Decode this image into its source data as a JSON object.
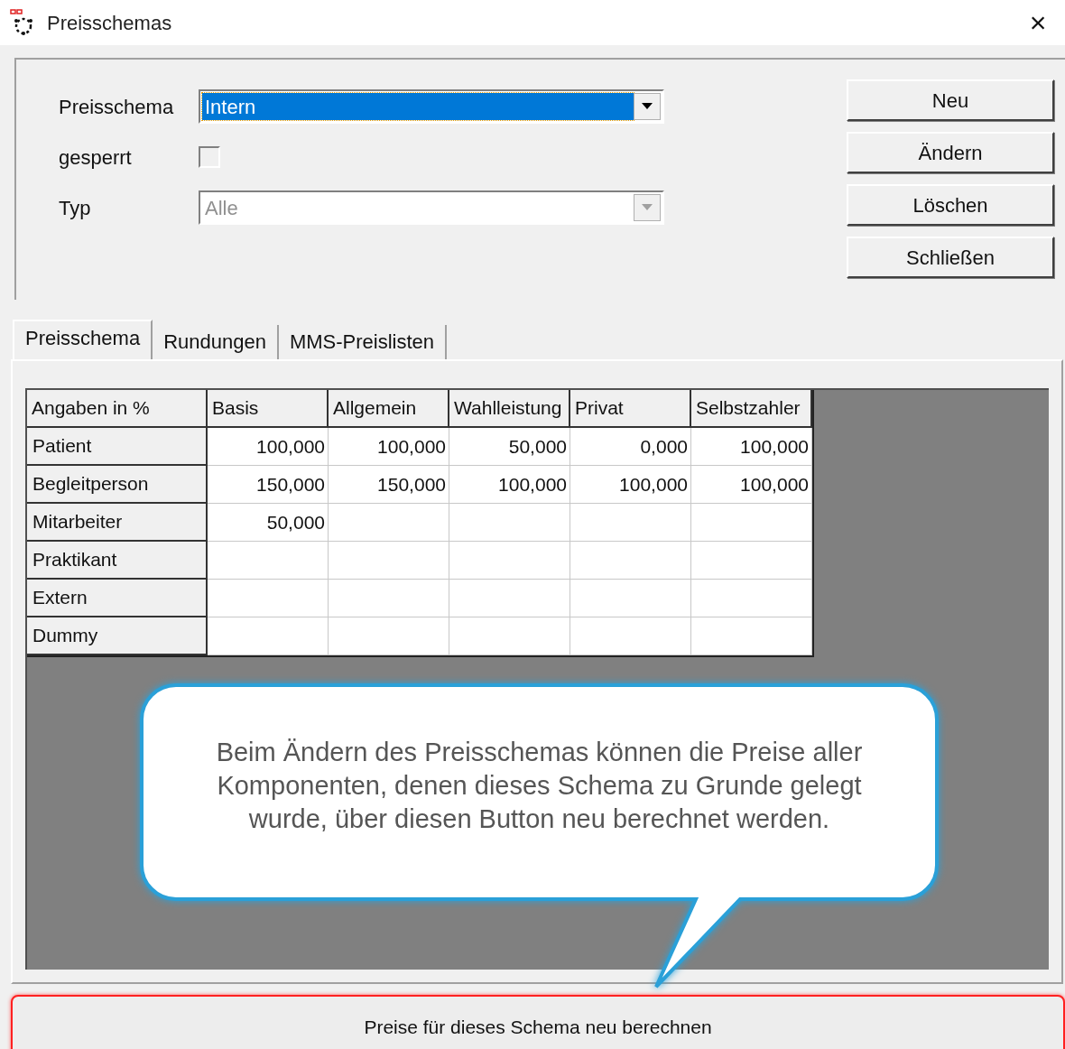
{
  "window": {
    "title": "Preisschemas",
    "close": "×"
  },
  "form": {
    "fields": [
      {
        "kind": "combo",
        "label": "Preisschema",
        "value": "Intern",
        "disabled": false,
        "focused": true
      },
      {
        "kind": "checkbox",
        "label": "gesperrt",
        "checked": false
      },
      {
        "kind": "combo",
        "label": "Typ",
        "value": "Alle",
        "disabled": true,
        "focused": false
      }
    ]
  },
  "buttons": [
    "Neu",
    "Ändern",
    "Löschen",
    "Schließen"
  ],
  "tabs": [
    {
      "label": "Preisschema",
      "selected": true
    },
    {
      "label": "Rundungen",
      "selected": false
    },
    {
      "label": "MMS-Preislisten",
      "selected": false
    }
  ],
  "table": {
    "columns": [
      "Angaben in %",
      "Basis",
      "Allgemein",
      "Wahlleistung",
      "Privat",
      "Selbstzahler"
    ],
    "rows": [
      {
        "cells": [
          "Patient",
          "100,000",
          "100,000",
          "50,000",
          "0,000",
          "100,000"
        ]
      },
      {
        "cells": [
          "Begleitperson",
          "150,000",
          "150,000",
          "100,000",
          "100,000",
          "100,000"
        ]
      },
      {
        "cells": [
          "Mitarbeiter",
          "50,000",
          "",
          "",
          "",
          ""
        ]
      },
      {
        "cells": [
          "Praktikant",
          "",
          "",
          "",
          "",
          ""
        ]
      },
      {
        "cells": [
          "Extern",
          "",
          "",
          "",
          "",
          ""
        ]
      },
      {
        "cells": [
          "Dummy",
          "",
          "",
          "",
          "",
          ""
        ]
      }
    ]
  },
  "callout": {
    "text": "Beim Ändern des Preisschemas können die Preise aller Komponenten, denen dieses Schema zu Grunde gelegt wurde, über diesen Button neu berechnet werden."
  },
  "recalc_button": {
    "label": "Preise für dieses Schema neu berechnen",
    "highlighted": true
  }
}
